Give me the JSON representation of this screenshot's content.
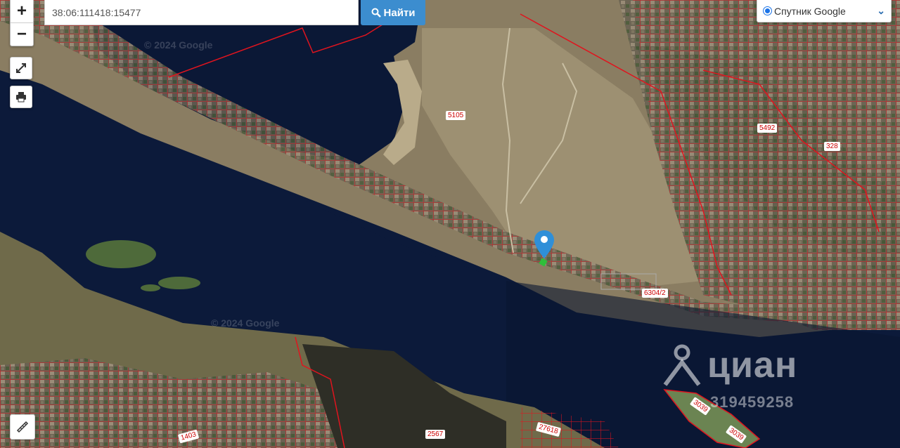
{
  "search": {
    "value": "38:06:111418:15477",
    "button_label": "Найти"
  },
  "zoom": {
    "in_label": "+",
    "out_label": "−"
  },
  "layer": {
    "selected": "Спутник Google"
  },
  "tools": {
    "fullscreen_icon": "expand-icon",
    "print_icon": "printer-icon",
    "ruler_icon": "ruler-icon"
  },
  "copyright": [
    "© 2024 Google",
    "© 2024 Google"
  ],
  "parcel_labels": [
    "5105",
    "5492",
    "328",
    "6304/2",
    "3039",
    "3039",
    "1403",
    "2567",
    "27618"
  ],
  "watermark": {
    "brand": "циан",
    "id": "319459258"
  },
  "colors": {
    "parcel_border": "#e0141e",
    "water": "#0c1a3a",
    "button_blue": "#3c8dcf",
    "marker": "#2f8fd8"
  }
}
